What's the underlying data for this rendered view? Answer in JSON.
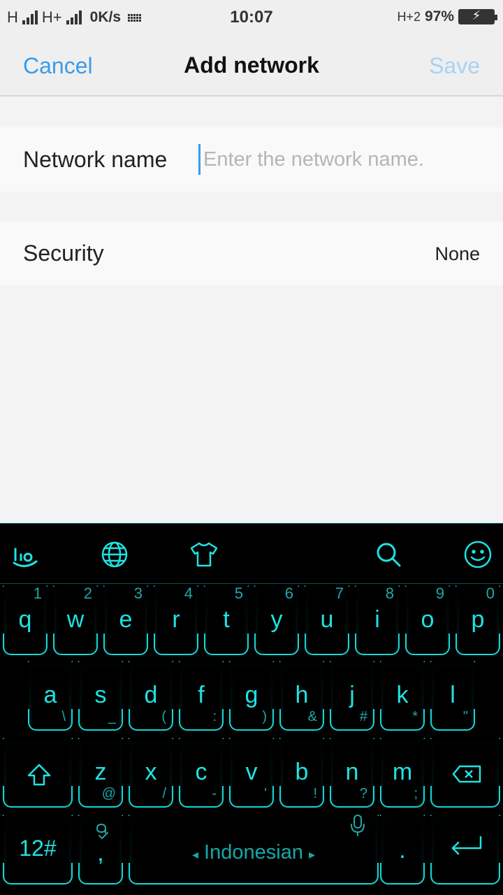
{
  "status_bar": {
    "net1": "H",
    "net2": "H+",
    "speed": "0K/s",
    "time": "10:07",
    "net3": "H+2",
    "battery": "97%"
  },
  "header": {
    "cancel": "Cancel",
    "title": "Add network",
    "save": "Save"
  },
  "form": {
    "network_name_label": "Network name",
    "network_name_placeholder": "Enter the network name.",
    "security_label": "Security",
    "security_value": "None"
  },
  "keyboard": {
    "row1": [
      {
        "key": "q",
        "sub": "1"
      },
      {
        "key": "w",
        "sub": "2"
      },
      {
        "key": "e",
        "sub": "3"
      },
      {
        "key": "r",
        "sub": "4"
      },
      {
        "key": "t",
        "sub": "5"
      },
      {
        "key": "y",
        "sub": "6"
      },
      {
        "key": "u",
        "sub": "7"
      },
      {
        "key": "i",
        "sub": "8"
      },
      {
        "key": "o",
        "sub": "9"
      },
      {
        "key": "p",
        "sub": "0"
      }
    ],
    "row2": [
      {
        "key": "a",
        "sub": "\\"
      },
      {
        "key": "s",
        "sub": "_"
      },
      {
        "key": "d",
        "sub": "("
      },
      {
        "key": "f",
        "sub": ":"
      },
      {
        "key": "g",
        "sub": ")"
      },
      {
        "key": "h",
        "sub": "&"
      },
      {
        "key": "j",
        "sub": "#"
      },
      {
        "key": "k",
        "sub": "*"
      },
      {
        "key": "l",
        "sub": "\""
      }
    ],
    "row3": [
      {
        "key": "z",
        "sub": "@"
      },
      {
        "key": "x",
        "sub": "/"
      },
      {
        "key": "c",
        "sub": "-"
      },
      {
        "key": "v",
        "sub": "'"
      },
      {
        "key": "b",
        "sub": "!"
      },
      {
        "key": "n",
        "sub": "?"
      },
      {
        "key": "m",
        "sub": ";"
      }
    ],
    "symbols_key": "12#",
    "comma_key": ",",
    "language": "Indonesian",
    "period_key": ".",
    "lang_left": "◂",
    "lang_right": "▸"
  },
  "colors": {
    "accent": "#3a9bea",
    "keyboard_glow": "#16d6d6"
  }
}
